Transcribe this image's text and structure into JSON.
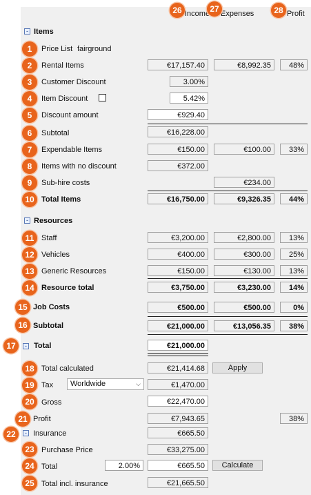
{
  "headers": {
    "income": "Income",
    "expenses": "Expenses",
    "profit": "Profit"
  },
  "sections": {
    "items": "Items",
    "resources": "Resources",
    "total": "Total",
    "toggle_symbol": "-"
  },
  "badges": [
    "1",
    "2",
    "3",
    "4",
    "5",
    "6",
    "7",
    "8",
    "9",
    "10",
    "11",
    "12",
    "13",
    "14",
    "15",
    "16",
    "17",
    "18",
    "19",
    "20",
    "21",
    "22",
    "23",
    "24",
    "25",
    "26",
    "27",
    "28"
  ],
  "price_list": {
    "label": "Price List",
    "value": "fairground"
  },
  "rental_items": {
    "label": "Rental Items",
    "income": "€17,157.40",
    "expenses": "€8,992.35",
    "profit": "48%"
  },
  "customer_discount": {
    "label": "Customer Discount",
    "value": "3.00%"
  },
  "item_discount": {
    "label": "Item Discount",
    "value": "5.42%"
  },
  "discount_amount": {
    "label": "Discount amount",
    "value": "€929.40"
  },
  "subtotal_items": {
    "label": "Subtotal",
    "value": "€16,228.00"
  },
  "expendable": {
    "label": "Expendable Items",
    "income": "€150.00",
    "expenses": "€100.00",
    "profit": "33%"
  },
  "no_discount": {
    "label": "Items with no discount",
    "value": "€372.00"
  },
  "subhire": {
    "label": "Sub-hire costs",
    "expenses": "€234.00"
  },
  "total_items": {
    "label": "Total Items",
    "income": "€16,750.00",
    "expenses": "€9,326.35",
    "profit": "44%"
  },
  "staff": {
    "label": "Staff",
    "income": "€3,200.00",
    "expenses": "€2,800.00",
    "profit": "13%"
  },
  "vehicles": {
    "label": "Vehicles",
    "income": "€400.00",
    "expenses": "€300.00",
    "profit": "25%"
  },
  "generic": {
    "label": "Generic Resources",
    "income": "€150.00",
    "expenses": "€130.00",
    "profit": "13%"
  },
  "resource_total": {
    "label": "Resource total",
    "income": "€3,750.00",
    "expenses": "€3,230.00",
    "profit": "14%"
  },
  "job_costs": {
    "label": "Job Costs",
    "income": "€500.00",
    "expenses": "€500.00",
    "profit": "0%"
  },
  "subtotal": {
    "label": "Subtotal",
    "income": "€21,000.00",
    "expenses": "€13,056.35",
    "profit": "38%"
  },
  "total": {
    "value": "€21,000.00"
  },
  "total_calculated": {
    "label": "Total calculated",
    "value": "€21,414.68",
    "button": "Apply"
  },
  "tax": {
    "label": "Tax",
    "select": "Worldwide",
    "value": "€1,470.00"
  },
  "gross": {
    "label": "Gross",
    "value": "€22,470.00"
  },
  "profit_row": {
    "label": "Profit",
    "value": "€7,943.65",
    "percent": "38%"
  },
  "insurance": {
    "label": "Insurance",
    "value": "€665.50"
  },
  "purchase_price": {
    "label": "Purchase Price",
    "value": "€33,275.00"
  },
  "ins_total": {
    "label": "Total",
    "percent": "2.00%",
    "value": "€665.50",
    "button": "Calculate"
  },
  "total_incl": {
    "label": "Total incl. insurance",
    "value": "€21,665.50"
  }
}
